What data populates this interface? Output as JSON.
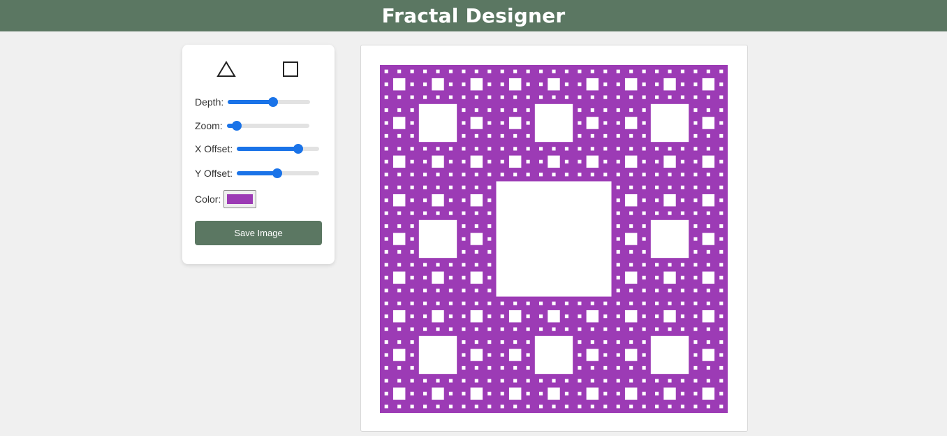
{
  "header": {
    "title": "Fractal Designer"
  },
  "shapes": [
    {
      "name": "triangle-icon",
      "label": "Triangle"
    },
    {
      "name": "square-icon",
      "label": "Square"
    }
  ],
  "controls": {
    "depth": {
      "label": "Depth:",
      "value": 0.55
    },
    "zoom": {
      "label": "Zoom:",
      "value": 0.12
    },
    "x_offset": {
      "label": "X Offset:",
      "value": 0.74
    },
    "y_offset": {
      "label": "Y Offset:",
      "value": 0.49
    },
    "color": {
      "label": "Color:",
      "value": "#9c3bb5"
    }
  },
  "save_button": {
    "label": "Save Image"
  },
  "fractal": {
    "type": "sierpinski-carpet",
    "color": "#9c3bb5",
    "depth": 4
  },
  "colors": {
    "header": "#5b7762",
    "accent": "#1a73e8",
    "button": "#5b7762"
  }
}
